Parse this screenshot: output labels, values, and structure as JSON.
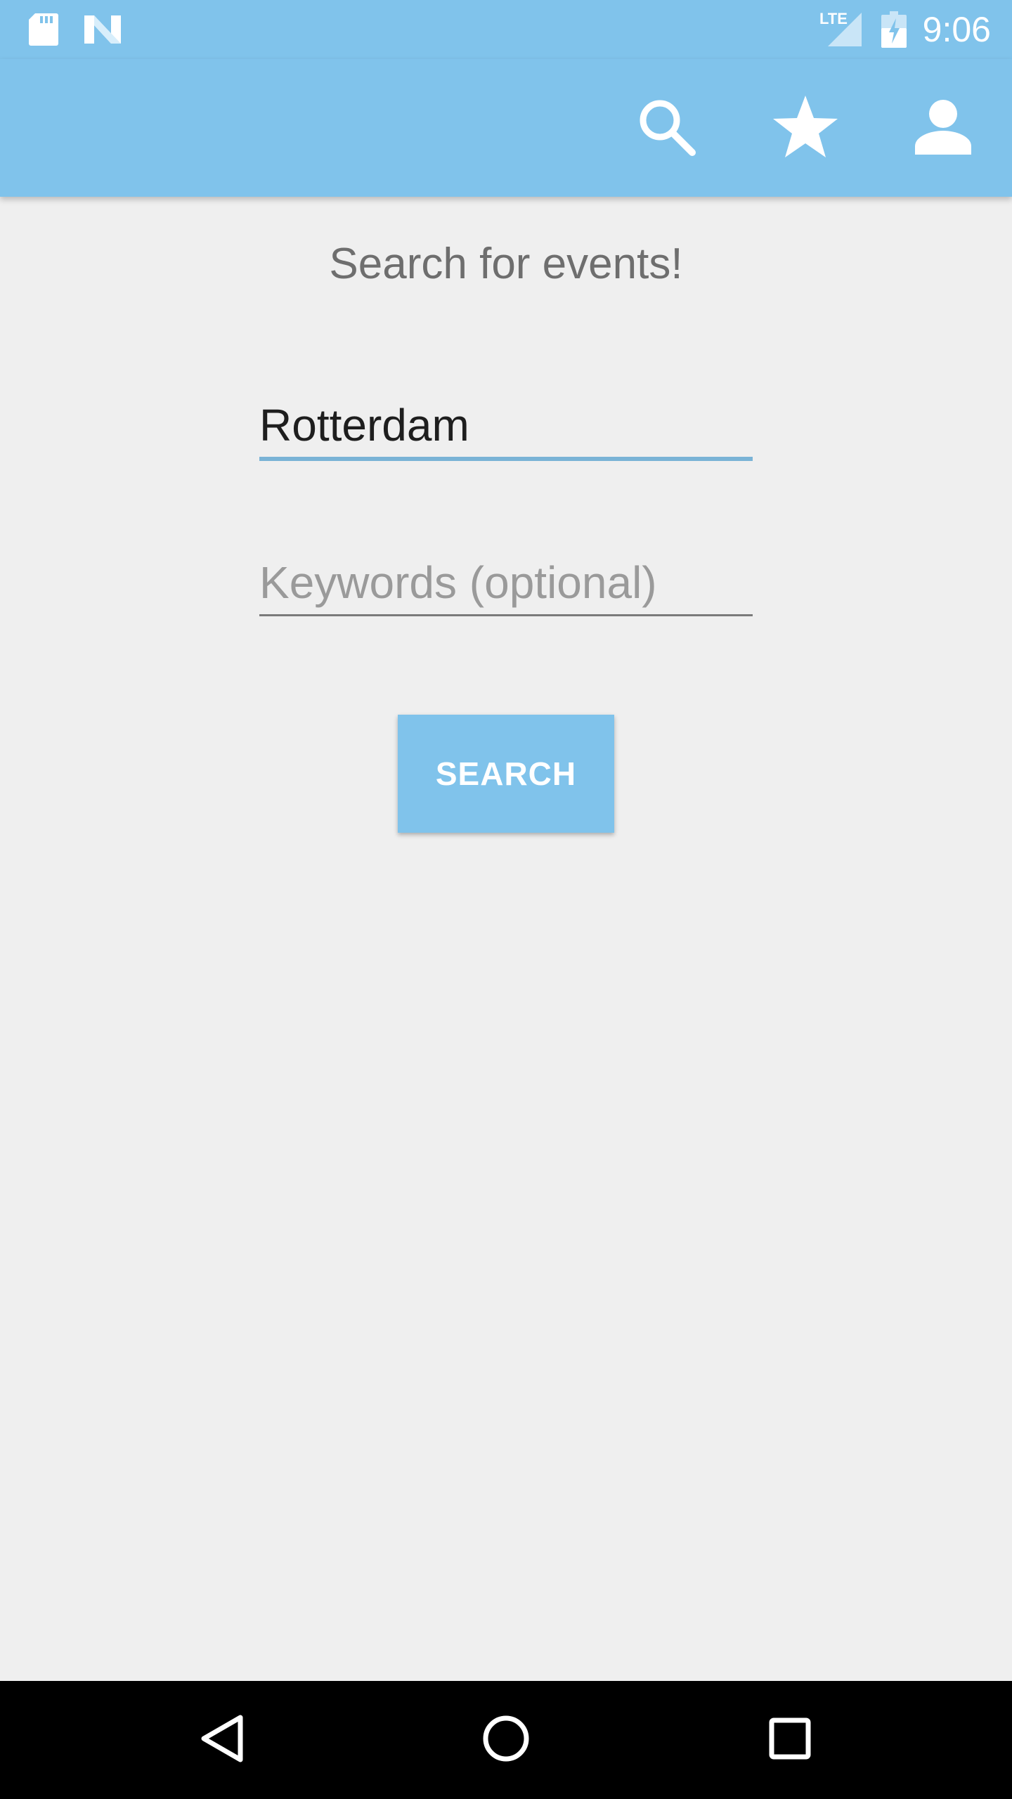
{
  "status_bar": {
    "time": "9:06",
    "network": "LTE",
    "icons": [
      "sd-card-icon",
      "n-logo-icon",
      "signal-icon",
      "battery-charging-icon"
    ]
  },
  "app_bar": {
    "background": "#80c3eb",
    "actions": [
      {
        "icon": "search-icon"
      },
      {
        "icon": "star-icon"
      },
      {
        "icon": "account-icon"
      }
    ]
  },
  "main": {
    "heading": "Search for events!",
    "city_field": {
      "value": "Rotterdam",
      "placeholder": ""
    },
    "keywords_field": {
      "value": "",
      "placeholder": "Keywords (optional)"
    },
    "search_button_label": "SEARCH"
  },
  "nav_bar": {
    "buttons": [
      {
        "icon": "back-icon"
      },
      {
        "icon": "home-icon"
      },
      {
        "icon": "recents-icon"
      }
    ]
  },
  "colors": {
    "accent": "#80c3eb",
    "background": "#efefef",
    "focused_underline": "#7ab3d6"
  }
}
